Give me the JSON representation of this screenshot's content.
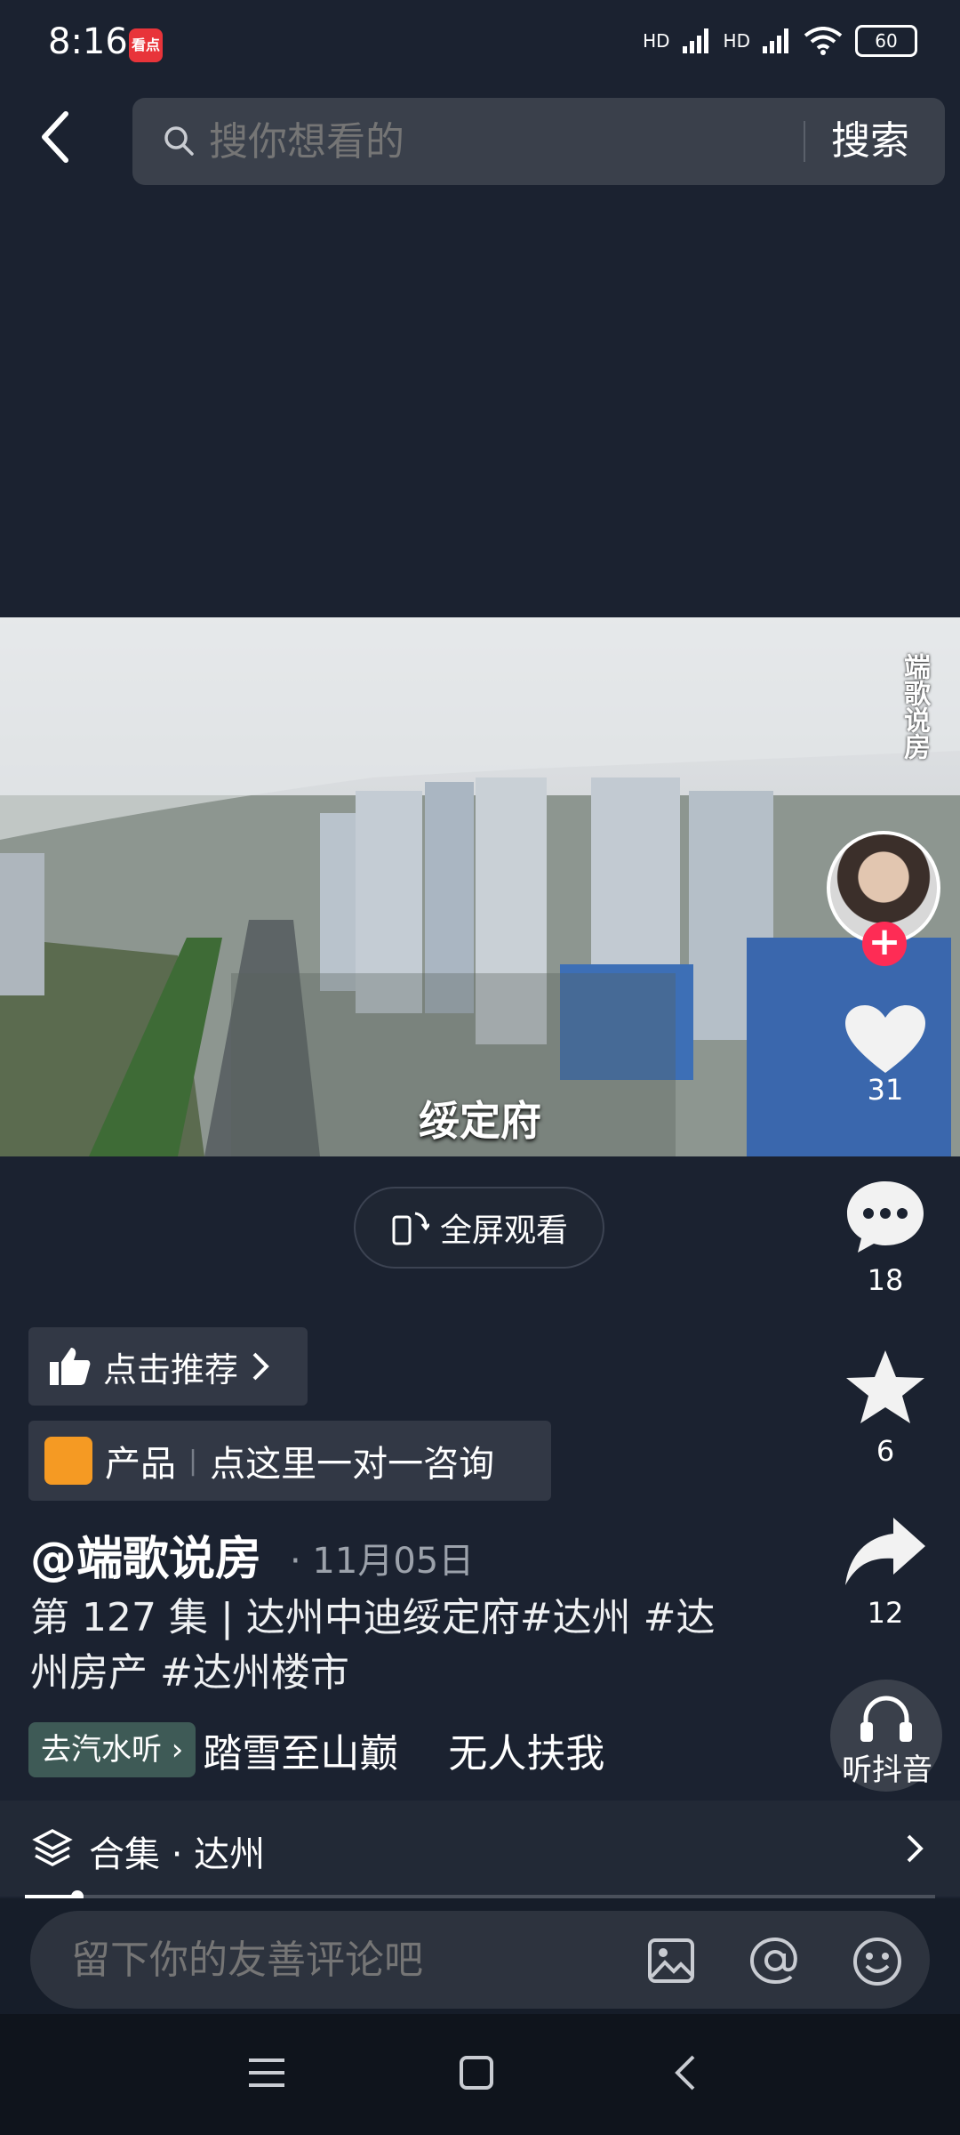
{
  "status_bar": {
    "time": "8:16",
    "app_badge": "看点",
    "hd1": "HD",
    "hd2": "HD",
    "battery": "60"
  },
  "search": {
    "placeholder": "搜你想看的",
    "button": "搜索"
  },
  "video": {
    "caption": "绥定府",
    "watermark": "端歌说房"
  },
  "fullscreen": {
    "label": "全屏观看"
  },
  "rail": {
    "likes": "31",
    "comments": "18",
    "favorites": "6",
    "shares": "12",
    "listen_label": "听抖音"
  },
  "recommend": {
    "label": "点击推荐"
  },
  "product": {
    "tag": "产品",
    "label": "点这里一对一咨询"
  },
  "post": {
    "author": "@端歌说房",
    "date": "· 11月05日",
    "description": "第 127 集 | 达州中迪绥定府#达州 #达州房产 #达州楼市",
    "music_button": "去汽水听",
    "music_text": "踏雪至山巅    无人扶我"
  },
  "collection": {
    "label": "合集 · 达州"
  },
  "progress": {
    "fraction": 0.058
  },
  "comment": {
    "placeholder": "留下你的友善评论吧"
  }
}
